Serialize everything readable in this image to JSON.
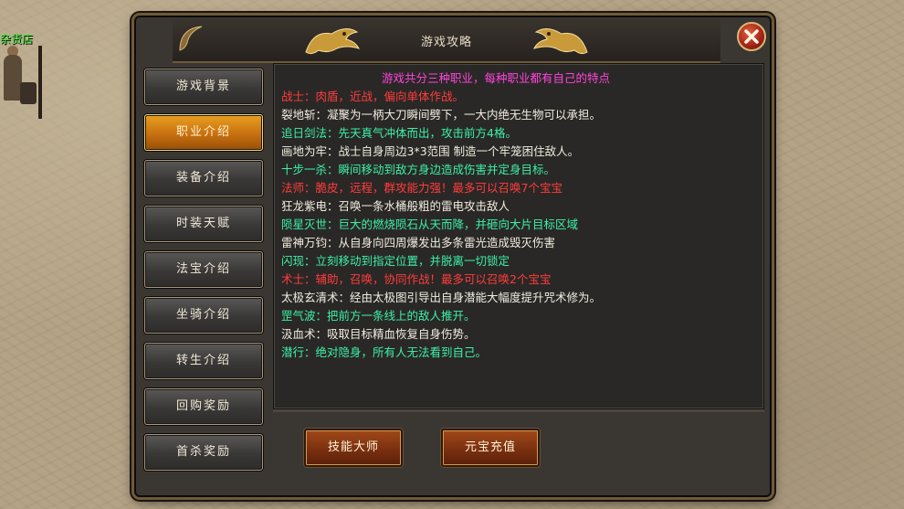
{
  "background": {
    "shop_label": "杂货店"
  },
  "window": {
    "title": "游戏攻略",
    "close_icon": "close-icon"
  },
  "sidebar": {
    "items": [
      {
        "label": "游戏背景",
        "active": false
      },
      {
        "label": "职业介绍",
        "active": true
      },
      {
        "label": "装备介绍",
        "active": false
      },
      {
        "label": "时装天赋",
        "active": false
      },
      {
        "label": "法宝介绍",
        "active": false
      },
      {
        "label": "坐骑介绍",
        "active": false
      },
      {
        "label": "转生介绍",
        "active": false
      },
      {
        "label": "回购奖励",
        "active": false
      },
      {
        "label": "首杀奖励",
        "active": false
      }
    ]
  },
  "content": {
    "lines": [
      {
        "text": "游戏共分三种职业，每种职业都有自己的特点",
        "color": "#ff44dd",
        "heading": true
      },
      {
        "text": "战士：肉盾，近战，偏向单体作战。",
        "color": "#ff3c3c"
      },
      {
        "text": "裂地斩：凝聚为一柄大刀瞬间劈下，一大内绝无生物可以承担。",
        "color": "#f0ece0"
      },
      {
        "text": "追日剑法：先天真气冲体而出，攻击前方4格。",
        "color": "#3cf0a8"
      },
      {
        "text": "画地为牢：战士自身周边3*3范围 制造一个牢笼困住敌人。",
        "color": "#f0ece0"
      },
      {
        "text": "十步一杀：瞬间移动到敌方身边造成伤害并定身目标。",
        "color": "#3cf0a8"
      },
      {
        "text": "法师：脆皮，远程，群攻能力强！最多可以召唤7个宝宝",
        "color": "#ff3c3c"
      },
      {
        "text": "狂龙紫电：召唤一条水桶般粗的雷电攻击敌人",
        "color": "#f0ece0"
      },
      {
        "text": "陨星灭世：巨大的燃烧陨石从天而降，并砸向大片目标区域",
        "color": "#3cf0a8"
      },
      {
        "text": "雷神万钧：从自身向四周爆发出多条雷光造成毁灭伤害",
        "color": "#f0ece0"
      },
      {
        "text": "闪现：立刻移动到指定位置，并脱离一切锁定",
        "color": "#3cf0a8"
      },
      {
        "text": "术士：辅助，召唤，协同作战！最多可以召唤2个宝宝",
        "color": "#ff3c3c"
      },
      {
        "text": "太极玄清术：经由太极图引导出自身潜能大幅度提升咒术修为。",
        "color": "#f0ece0"
      },
      {
        "text": "罡气波：把前方一条线上的敌人推开。",
        "color": "#3cf0a8"
      },
      {
        "text": "汲血术：吸取目标精血恢复自身伤势。",
        "color": "#f0ece0"
      },
      {
        "text": "潜行：绝对隐身，所有人无法看到自己。",
        "color": "#3cf0a8"
      }
    ]
  },
  "buttons": {
    "skill_master": "技能大师",
    "recharge": "元宝充值"
  }
}
